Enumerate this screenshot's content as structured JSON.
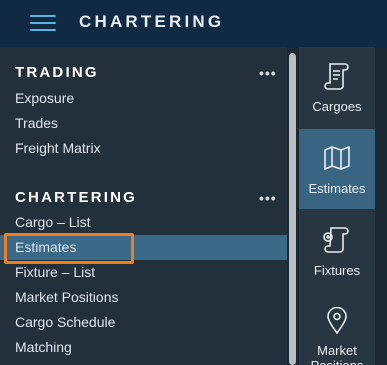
{
  "header": {
    "title": "CHARTERING"
  },
  "sections": [
    {
      "title": "TRADING",
      "more": "•••",
      "items": [
        "Exposure",
        "Trades",
        "Freight Matrix"
      ]
    },
    {
      "title": "CHARTERING",
      "more": "•••",
      "items": [
        "Cargo – List",
        "Estimates",
        "Fixture – List",
        "Market Positions",
        "Cargo Schedule",
        "Matching"
      ]
    }
  ],
  "selected_item": "Estimates",
  "rightbar": {
    "items": [
      {
        "label": "Cargoes",
        "icon": "scroll-icon"
      },
      {
        "label": "Estimates",
        "icon": "map-icon"
      },
      {
        "label": "Fixtures",
        "icon": "fixture-scroll-icon"
      },
      {
        "label": "Market Positions",
        "icon": "location-pin-icon"
      }
    ]
  },
  "colors": {
    "accent": "#f07d1e",
    "selected": "#3b6a88",
    "header": "#102a43"
  }
}
